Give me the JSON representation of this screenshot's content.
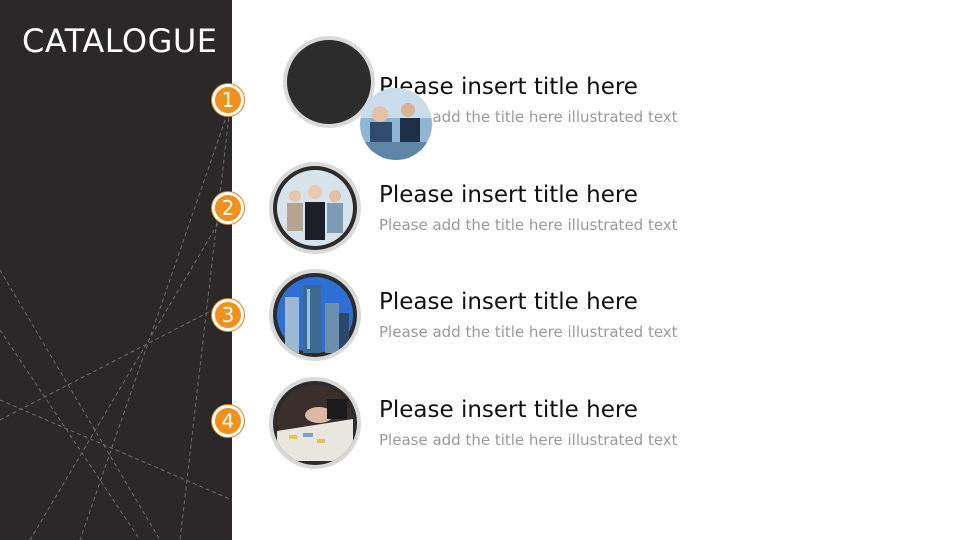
{
  "slide": {
    "heading": "CATALOGUE",
    "accent_color": "#f39019",
    "sidebar_color": "#2a2828"
  },
  "items": [
    {
      "number": "1",
      "title": "Please insert title here",
      "description": "Please add the title here illustrated text",
      "image": "business-meeting-photo"
    },
    {
      "number": "2",
      "title": "Please insert title here",
      "description": "Please add the title here illustrated text",
      "image": "business-people-photo"
    },
    {
      "number": "3",
      "title": "Please insert title here",
      "description": "Please add the title here illustrated text",
      "image": "skyscrapers-photo"
    },
    {
      "number": "4",
      "title": "Please insert title here",
      "description": "Please add the title here illustrated text",
      "image": "handshake-documents-photo"
    }
  ]
}
